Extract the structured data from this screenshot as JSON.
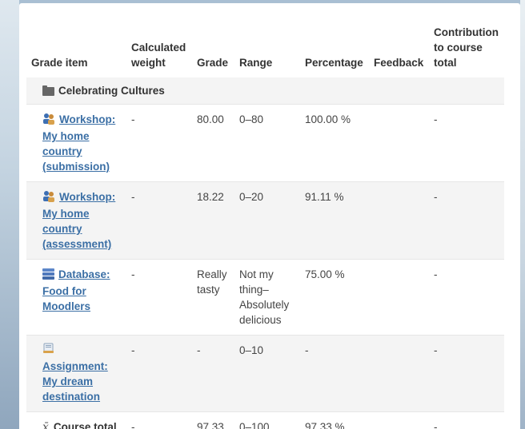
{
  "headers": {
    "grade_item": "Grade item",
    "calculated_weight": "Calculated weight",
    "grade": "Grade",
    "range": "Range",
    "percentage": "Percentage",
    "feedback": "Feedback",
    "contribution": "Contribution to course total"
  },
  "category": {
    "name": "Celebrating Cultures",
    "icon": "folder-icon"
  },
  "rows": [
    {
      "icon": "workshop-icon",
      "name": "Workshop: My home country (submission)",
      "weight": "-",
      "grade": "80.00",
      "range": "0–80",
      "percentage": "100.00 %",
      "feedback": "",
      "contribution": "-"
    },
    {
      "icon": "workshop-icon",
      "name": "Workshop: My home country (assessment)",
      "weight": "-",
      "grade": "18.22",
      "range": "0–20",
      "percentage": "91.11 %",
      "feedback": "",
      "contribution": "-"
    },
    {
      "icon": "database-icon",
      "name": "Database: Food for Moodlers",
      "weight": "-",
      "grade": "Really tasty",
      "range": "Not my thing–Absolutely delicious",
      "percentage": "75.00 %",
      "feedback": "",
      "contribution": "-"
    },
    {
      "icon": "assignment-icon",
      "name": "Assignment: My dream destination",
      "weight": "-",
      "grade": "-",
      "range": "0–10",
      "percentage": "-",
      "feedback": "",
      "contribution": "-"
    }
  ],
  "course_total": {
    "icon": "sigma-icon",
    "symbol": "x̄",
    "name": "Course total",
    "weight": "-",
    "grade": "97.33",
    "range": "0–100",
    "percentage": "97.33 %",
    "feedback": "",
    "contribution": "-"
  }
}
